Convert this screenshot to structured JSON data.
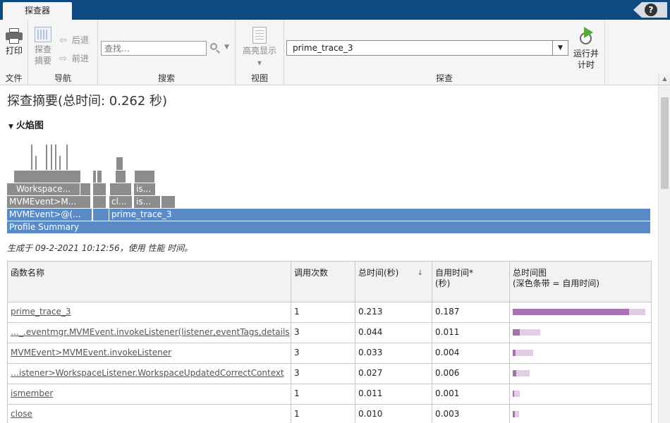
{
  "tabs": {
    "active_tab": "探查器"
  },
  "help": {
    "glyph": "?"
  },
  "toolstrip": {
    "sections": {
      "file": "文件",
      "navigation": "导航",
      "search": "搜索",
      "view": "视图",
      "profile": "探查"
    },
    "print_label": "打印",
    "profile_summary_label_1": "探查",
    "profile_summary_label_2": "摘要",
    "back_label": "后退",
    "forward_label": "前进",
    "search_placeholder": "查找...",
    "highlight_label": "高亮显示",
    "profile_target": "prime_trace_3",
    "run_label_1": "运行并",
    "run_label_2": "计时"
  },
  "content": {
    "title": "探查摘要(总时间: 0.262 秒)",
    "flamegraph_header": "火焰图",
    "flamegraph_labels": {
      "root": "Profile Summary",
      "prime": "prime_trace_3",
      "mvm_event_at": "MVMEvent>@(...",
      "mvm_event_m": "MVMEvent>M...",
      "cl": "cl...",
      "is1": "is...",
      "workspace": "Workspace...",
      "is2": "is..."
    },
    "generated_text": "生成于 09-2-2021 10:12:56，使用 性能 时间。",
    "table": {
      "headers": {
        "function_name": "函数名称",
        "calls": "调用次数",
        "total_time": "总时间(秒)",
        "self_time_1": "自用时间*",
        "self_time_2": "(秒)",
        "plot_1": "总时间图",
        "plot_2": "(深色条带 = 自用时间)"
      },
      "rows": [
        {
          "name": "prime_trace_3",
          "calls": "1",
          "total": "0.213",
          "self": "0.187",
          "total_frac": 1.0,
          "self_frac": 0.878
        },
        {
          "name": "…_.eventmgr.MVMEvent.invokeListener(listener,eventTags,details)",
          "calls": "3",
          "total": "0.044",
          "self": "0.011",
          "total_frac": 0.207,
          "self_frac": 0.052
        },
        {
          "name": "MVMEvent>MVMEvent.invokeListener",
          "calls": "3",
          "total": "0.033",
          "self": "0.004",
          "total_frac": 0.155,
          "self_frac": 0.019
        },
        {
          "name": "…istener>WorkspaceListener.WorkspaceUpdatedCorrectContext",
          "calls": "3",
          "total": "0.027",
          "self": "0.006",
          "total_frac": 0.127,
          "self_frac": 0.028
        },
        {
          "name": "ismember",
          "calls": "1",
          "total": "0.011",
          "self": "0.001",
          "total_frac": 0.052,
          "self_frac": 0.005
        },
        {
          "name": "close",
          "calls": "1",
          "total": "0.010",
          "self": "0.003",
          "total_frac": 0.047,
          "self_frac": 0.014
        }
      ]
    }
  }
}
